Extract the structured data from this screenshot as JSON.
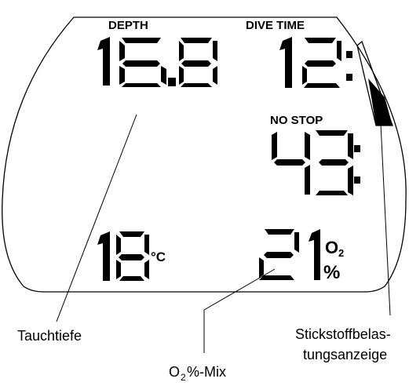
{
  "display": {
    "depth_label": "DEPTH",
    "depth_value": "16.8",
    "dive_time_label": "DIVE TIME",
    "dive_time_value": "12:",
    "no_stop_label": "NO STOP",
    "no_stop_value": "43:",
    "temperature_value": "18",
    "temperature_unit": "°C",
    "o2_value": "21",
    "o2_symbol": "O",
    "o2_subscript": "2",
    "o2_unit": "%"
  },
  "callouts": {
    "depth": "Tauchtiefe",
    "o2_mix_prefix": "O",
    "o2_mix_subscript": "2",
    "o2_mix_suffix": "%-Mix",
    "nitrogen_line1": "Stickstoffbelas-",
    "nitrogen_line2": "tungsanzeige"
  },
  "colors": {
    "ink": "#000000",
    "background": "#ffffff"
  }
}
